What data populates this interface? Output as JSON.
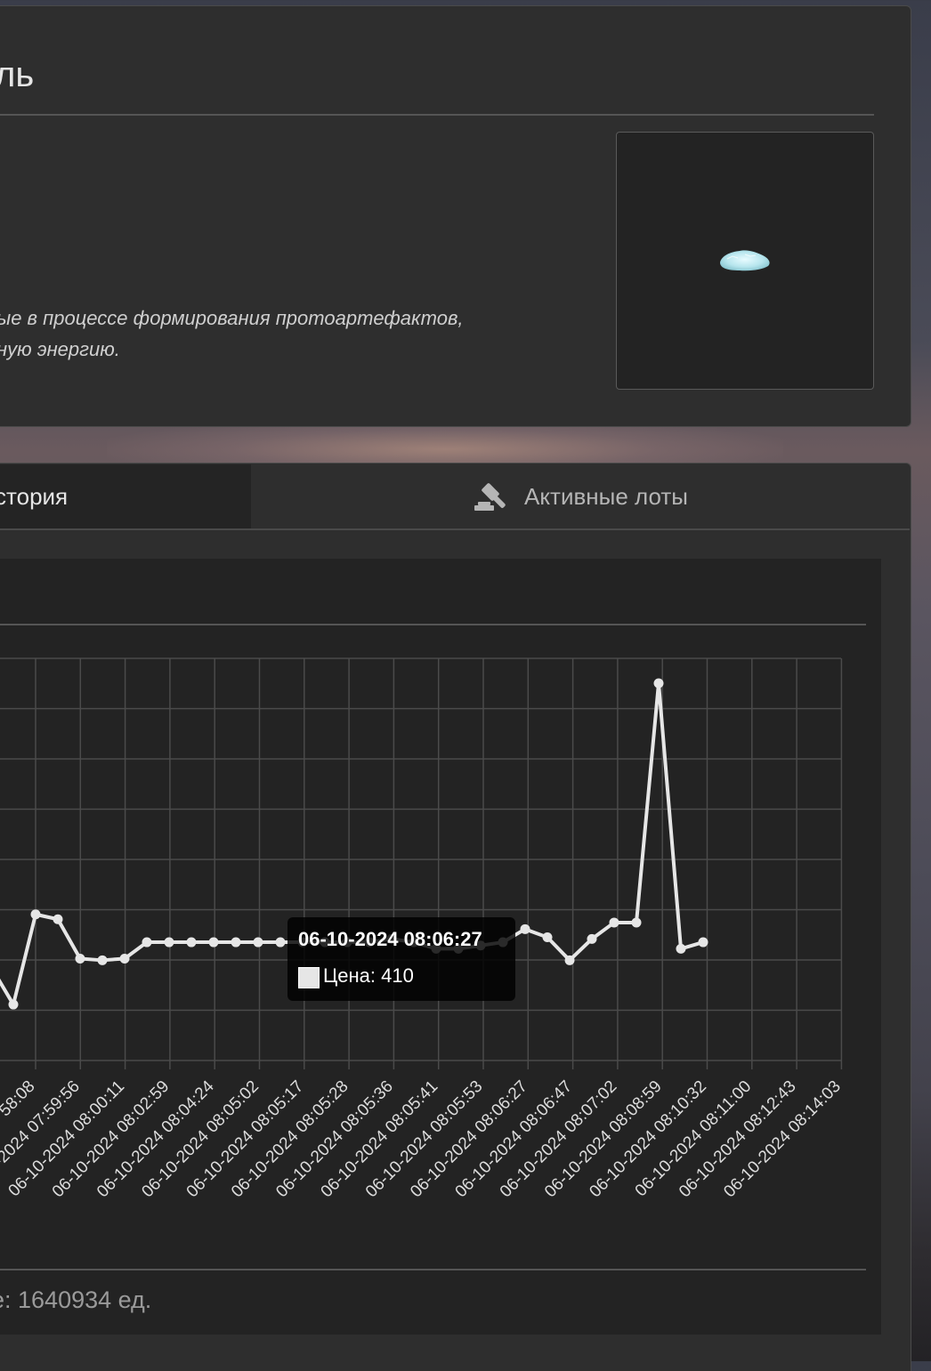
{
  "item": {
    "title": "ль",
    "description_line1": "ые в процессе формирования протоартефактов,",
    "description_line2": "ную энергию."
  },
  "tabs": {
    "history_label": "стория",
    "active_lots_label": "Активные лоты",
    "active_lots_icon": "gavel-icon"
  },
  "chart_data": {
    "type": "line",
    "x": [
      "58:08",
      "06-10-2024 07:59:56",
      "06-10-2024 08:00:11",
      "06-10-2024 08:02:59",
      "06-10-2024 08:04:24",
      "06-10-2024 08:05:02",
      "06-10-2024 08:05:17",
      "06-10-2024 08:05:28",
      "06-10-2024 08:05:36",
      "06-10-2024 08:05:41",
      "06-10-2024 08:05:53",
      "06-10-2024 08:06:27",
      "06-10-2024 08:06:47",
      "06-10-2024 08:07:02",
      "06-10-2024 08:08:59",
      "06-10-2024 08:10:32",
      "06-10-2024 08:11:00",
      "06-10-2024 08:12:43",
      "06-10-2024 08:14:03"
    ],
    "series": [
      {
        "values": [
          100,
          335,
          220,
          495,
          480,
          360,
          355,
          360,
          410,
          410,
          410,
          410,
          410,
          410,
          410,
          410,
          410,
          410,
          410,
          420,
          410,
          390,
          390,
          400,
          410,
          450,
          425,
          355,
          420,
          470,
          470,
          1200,
          390,
          410
        ]
      }
    ],
    "point_positions": [
      -35,
      -10,
      15,
      40,
      65,
      90,
      115,
      140,
      165,
      190,
      215,
      240,
      265,
      290,
      315,
      340,
      365,
      390,
      415,
      440,
      465,
      490,
      515,
      540,
      565,
      590,
      615,
      640,
      665,
      690,
      715,
      740,
      765,
      790,
      815,
      840,
      865,
      890,
      915,
      940
    ],
    "color": "#e6e6e6",
    "grid": true,
    "tooltip": {
      "title": "06-10-2024 08:06:27",
      "label": "Цена: 410"
    }
  },
  "footer": {
    "volume_text": "е: 1640934 ед."
  }
}
